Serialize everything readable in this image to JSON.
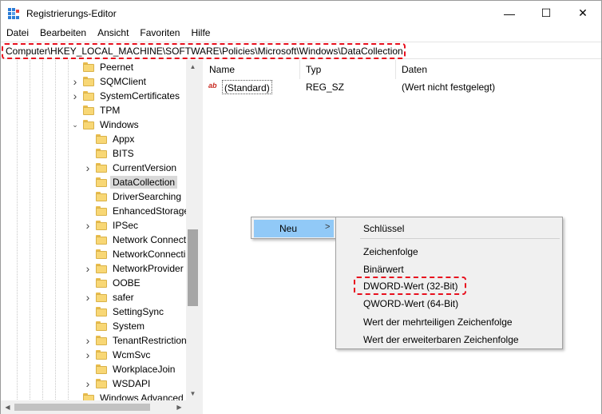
{
  "window": {
    "title": "Registrierungs-Editor",
    "controls": {
      "minimize": "—",
      "maximize": "☐",
      "close": "✕"
    }
  },
  "menubar": [
    "Datei",
    "Bearbeiten",
    "Ansicht",
    "Favoriten",
    "Hilfe"
  ],
  "address": {
    "path": "Computer\\HKEY_LOCAL_MACHINE\\SOFTWARE\\Policies\\Microsoft\\Windows\\DataCollection",
    "highlight_color": "#e8101e"
  },
  "tree": {
    "items": [
      {
        "label": "Peernet",
        "chevron": "",
        "level": 0
      },
      {
        "label": "SQMClient",
        "chevron": ">",
        "level": 0
      },
      {
        "label": "SystemCertificates",
        "chevron": ">",
        "level": 0
      },
      {
        "label": "TPM",
        "chevron": "",
        "level": 0
      },
      {
        "label": "Windows",
        "chevron": "v",
        "level": 0
      },
      {
        "label": "Appx",
        "chevron": "",
        "level": 1
      },
      {
        "label": "BITS",
        "chevron": "",
        "level": 1
      },
      {
        "label": "CurrentVersion",
        "chevron": ">",
        "level": 1
      },
      {
        "label": "DataCollection",
        "chevron": "",
        "level": 1,
        "selected": true
      },
      {
        "label": "DriverSearching",
        "chevron": "",
        "level": 1
      },
      {
        "label": "EnhancedStorage",
        "chevron": "",
        "level": 1
      },
      {
        "label": "IPSec",
        "chevron": ">",
        "level": 1
      },
      {
        "label": "Network Connect",
        "chevron": "",
        "level": 1
      },
      {
        "label": "NetworkConnecti",
        "chevron": "",
        "level": 1
      },
      {
        "label": "NetworkProvider",
        "chevron": ">",
        "level": 1
      },
      {
        "label": "OOBE",
        "chevron": "",
        "level": 1
      },
      {
        "label": "safer",
        "chevron": ">",
        "level": 1
      },
      {
        "label": "SettingSync",
        "chevron": "",
        "level": 1
      },
      {
        "label": "System",
        "chevron": "",
        "level": 1
      },
      {
        "label": "TenantRestriction",
        "chevron": ">",
        "level": 1
      },
      {
        "label": "WcmSvc",
        "chevron": ">",
        "level": 1
      },
      {
        "label": "WorkplaceJoin",
        "chevron": "",
        "level": 1
      },
      {
        "label": "WSDAPI",
        "chevron": ">",
        "level": 1
      },
      {
        "label": "Windows Advanced",
        "chevron": "",
        "level": 0
      }
    ]
  },
  "list": {
    "columns": [
      "Name",
      "Typ",
      "Daten"
    ],
    "rows": [
      {
        "name": "(Standard)",
        "type": "REG_SZ",
        "data": "(Wert nicht festgelegt)",
        "icon": "ab"
      }
    ]
  },
  "context_menu": {
    "parent_item": "Neu",
    "submenu_arrow": ">",
    "items": [
      "Schlüssel",
      "Zeichenfolge",
      "Binärwert",
      "DWORD-Wert (32-Bit)",
      "QWORD-Wert (64-Bit)",
      "Wert der mehrteiligen Zeichenfolge",
      "Wert der erweiterbaren Zeichenfolge"
    ]
  }
}
